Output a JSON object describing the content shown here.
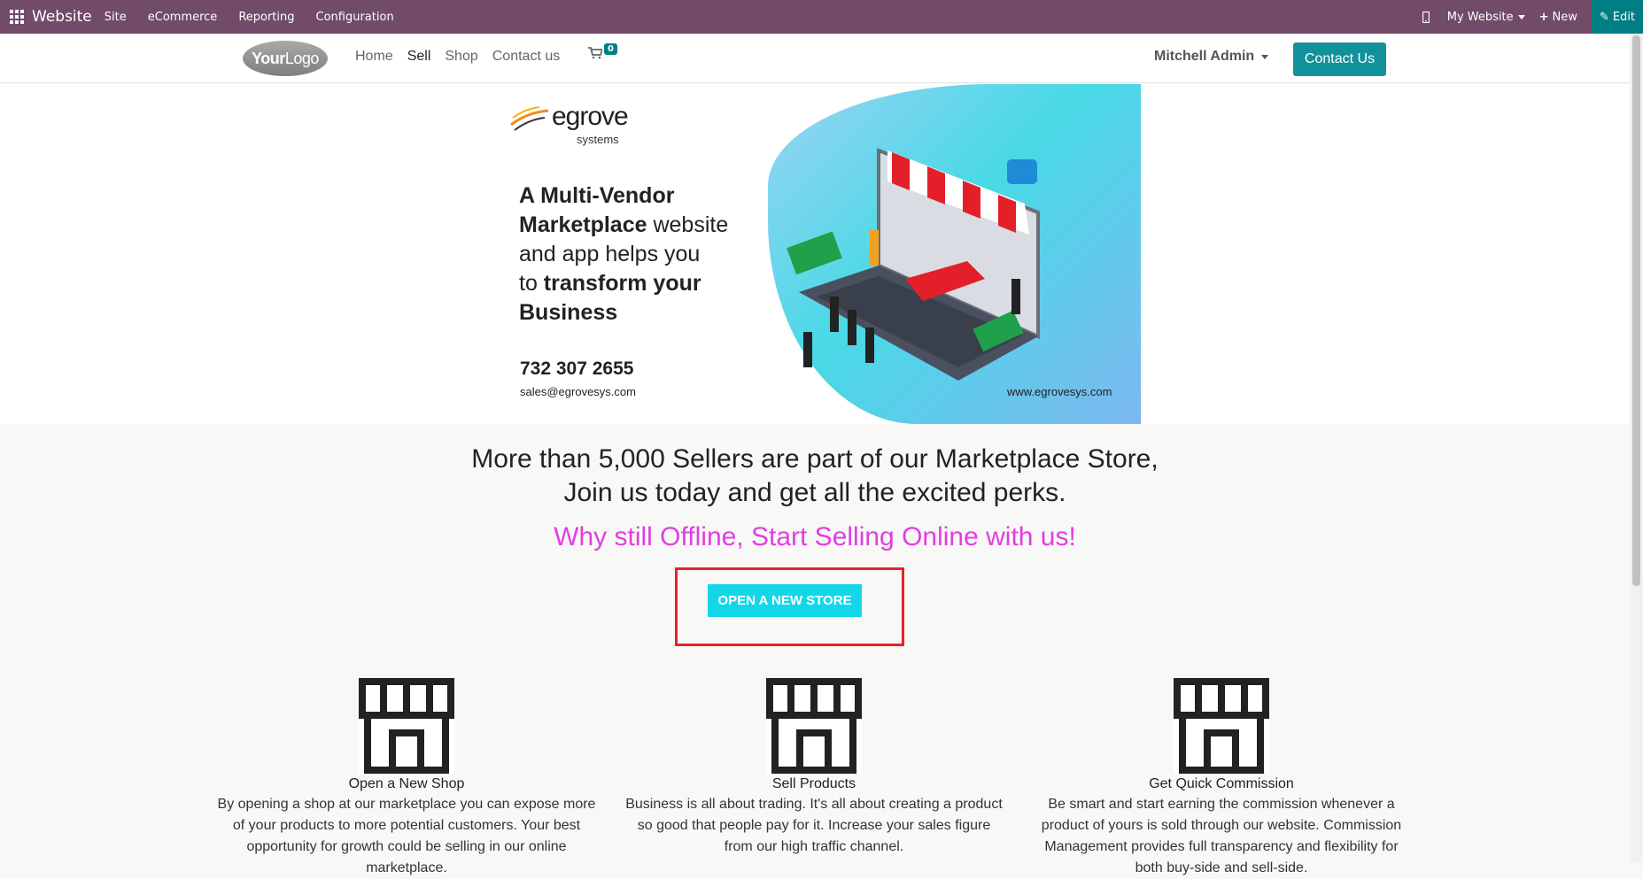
{
  "topbar": {
    "app_title": "Website",
    "menu": [
      "Site",
      "eCommerce",
      "Reporting",
      "Configuration"
    ],
    "website_selector": "My Website",
    "new_label": "New",
    "edit_label": "Edit"
  },
  "header": {
    "logo_text_bold": "Your",
    "logo_text": "Logo",
    "nav": [
      "Home",
      "Sell",
      "Shop",
      "Contact us"
    ],
    "cart_count": "0",
    "user": "Mitchell Admin",
    "contact_button": "Contact Us"
  },
  "banner": {
    "brand": "egrove",
    "brand_sub": "systems",
    "headline_1_bold": "A Multi-Vendor",
    "headline_2_bold": "Marketplace",
    "headline_2": " website",
    "headline_3": "and app helps you",
    "headline_4": "to ",
    "headline_4_bold": "transform your",
    "headline_5_bold": "Business",
    "phone": "732 307 2655",
    "email": "sales@egrovesys.com",
    "url": "www.egrovesys.com"
  },
  "main": {
    "lead_1": "More than 5,000 Sellers are part of our Marketplace Store,",
    "lead_2": "Join us today and get all the excited perks.",
    "tagline": "Why still Offline, Start Selling Online with us!",
    "open_store_button": "OPEN A NEW STORE"
  },
  "features": [
    {
      "title": "Open a New Shop",
      "desc": "By opening a shop at our marketplace you can expose more of your products to more potential customers. Your best opportunity for growth could be selling in our online marketplace."
    },
    {
      "title": "Sell Products",
      "desc": "Business is all about trading. It's all about creating a product so good that people pay for it. Increase your sales figure from our high traffic channel."
    },
    {
      "title": "Get Quick Commission",
      "desc": "Be smart and start earning the commission whenever a product of yours is sold through our website. Commission Management provides full transparency and flexibility for both buy-side and sell-side."
    }
  ],
  "colors": {
    "admin_bar": "#714b67",
    "edit_button": "#017e84",
    "contact_button": "#11929a",
    "store_button": "#13d7e8",
    "tagline": "#e23ee0",
    "highlight_box": "#e8202a"
  }
}
